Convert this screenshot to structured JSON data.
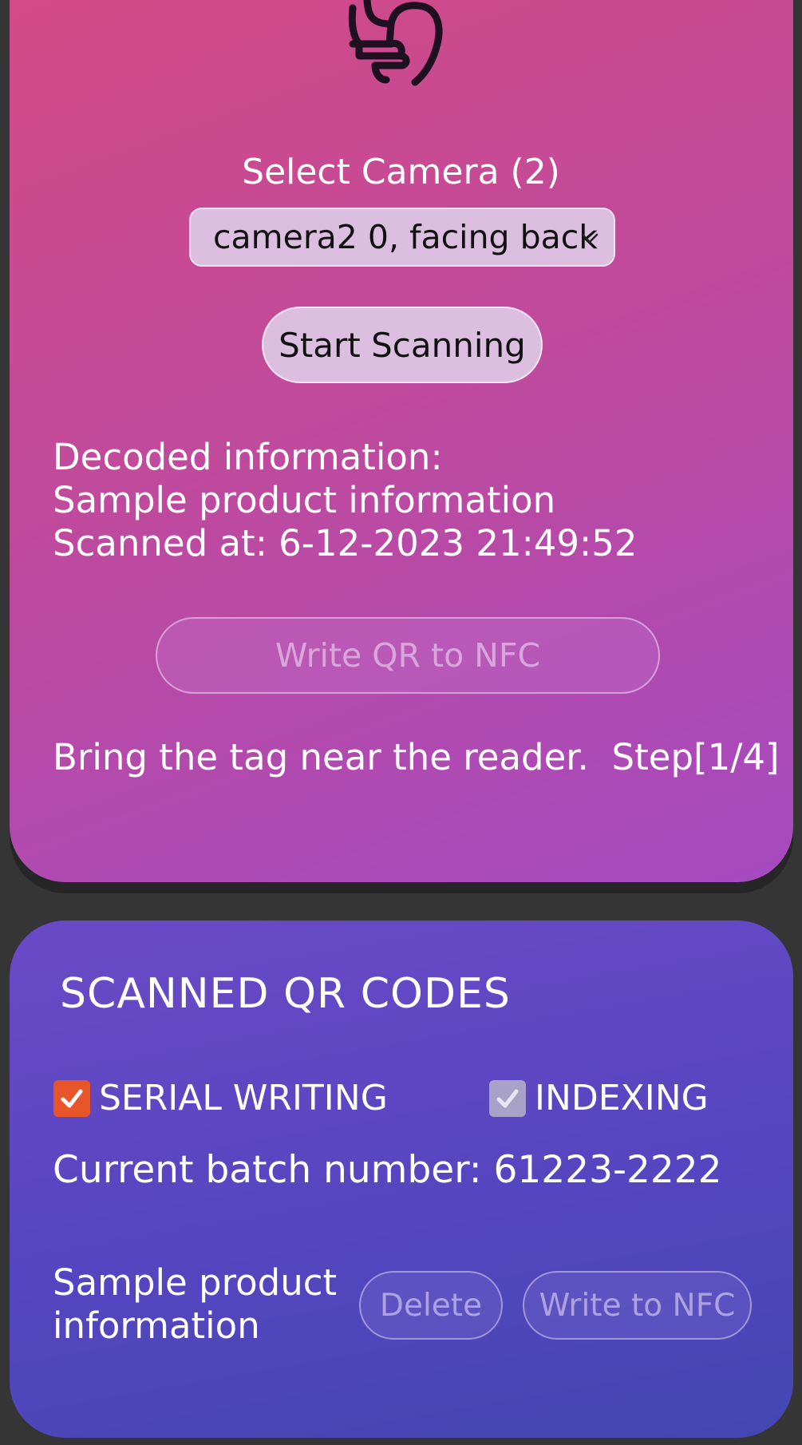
{
  "icons": {
    "hand": "hand-icon",
    "select_chevron": "chevron-down-icon",
    "checkmark": "check-icon"
  },
  "scanner": {
    "camera_label": "Select Camera (2)",
    "camera_selected": "camera2 0, facing back",
    "start_button": "Start Scanning",
    "decoded_title": "Decoded information:",
    "decoded_value": "Sample product information",
    "scanned_at": "Scanned at: 6-12-2023 21:49:52",
    "write_qr_button": "Write QR to NFC",
    "nfc_status": "Bring the tag near the reader.  Step[1/4]"
  },
  "scanned": {
    "title": "SCANNED QR CODES",
    "serial_writing": {
      "label": "SERIAL WRITING",
      "checked": true,
      "color": "#e8552b"
    },
    "indexing": {
      "label": "INDEXING",
      "checked": true,
      "disabled": true
    },
    "batch_text": "Current batch number: 61223-2222",
    "items": [
      {
        "text": "Sample product information",
        "delete_label": "Delete",
        "write_label": "Write to NFC"
      }
    ]
  },
  "colors": {
    "top_card_start": "#d24a86",
    "top_card_end": "#a44ac0",
    "bottom_card_start": "#6a4ac6",
    "bottom_card_end": "#4347b2",
    "background": "#353535"
  }
}
